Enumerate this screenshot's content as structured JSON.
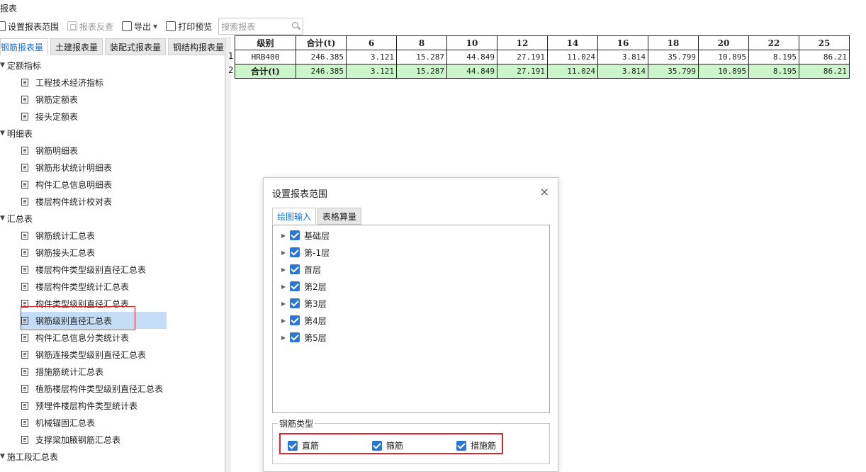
{
  "window": {
    "title": "报表"
  },
  "toolbar": {
    "set_range": "设置报表范围",
    "reverse": "报表反查",
    "export": "导出",
    "print_preview": "打印预览",
    "search_placeholder": "搜索报表"
  },
  "tabs": [
    "钢筋报表量",
    "土建报表量",
    "装配式报表量",
    "钢结构报表量"
  ],
  "tree": {
    "groups": [
      {
        "label": "定额指标",
        "items": [
          "工程技术经济指标",
          "钢筋定额表",
          "接头定额表"
        ]
      },
      {
        "label": "明细表",
        "items": [
          "钢筋明细表",
          "钢筋形状统计明细表",
          "构件汇总信息明细表",
          "楼层构件统计校对表"
        ]
      },
      {
        "label": "汇总表",
        "items": [
          "钢筋统计汇总表",
          "钢筋接头汇总表",
          "楼层构件类型级别直径汇总表",
          "楼层构件类型统计汇总表",
          "构件类型级别直径汇总表",
          "钢筋级别直径汇总表",
          "构件汇总信息分类统计表",
          "钢筋连接类型级别直径汇总表",
          "措施筋统计汇总表",
          "植筋楼层构件类型级别直径汇总表",
          "预埋件楼层构件类型统计表",
          "机械锚固汇总表",
          "支撑梁加腋钢筋汇总表"
        ]
      },
      {
        "label": "施工段汇总表",
        "items": []
      }
    ],
    "selected": "钢筋级别直径汇总表"
  },
  "report": {
    "row_numbers": [
      "1",
      "2"
    ],
    "headers": [
      "级别",
      "合计(t)",
      "6",
      "8",
      "10",
      "12",
      "14",
      "16",
      "18",
      "20",
      "22",
      "25"
    ],
    "rows": [
      [
        "HRB400",
        "246.385",
        "3.121",
        "15.287",
        "44.849",
        "27.191",
        "11.024",
        "3.814",
        "35.799",
        "10.895",
        "8.195",
        "86.21"
      ],
      [
        "合计(t)",
        "246.385",
        "3.121",
        "15.287",
        "44.849",
        "27.191",
        "11.024",
        "3.814",
        "35.799",
        "10.895",
        "8.195",
        "86.21"
      ]
    ]
  },
  "dialog": {
    "title": "设置报表范围",
    "close": "×",
    "tabs": [
      "绘图输入",
      "表格算量"
    ],
    "floors": [
      "基础层",
      "第-1层",
      "首层",
      "第2层",
      "第3层",
      "第4层",
      "第5层"
    ],
    "rebar_type_legend": "钢筋类型",
    "rebar_types": [
      "直筋",
      "箍筋",
      "措施筋"
    ]
  },
  "colors": {
    "accent": "#1a6fd0",
    "highlight_red": "#e0242c",
    "total_row": "#ccf5cc",
    "selected_row": "#c5dcf6"
  }
}
